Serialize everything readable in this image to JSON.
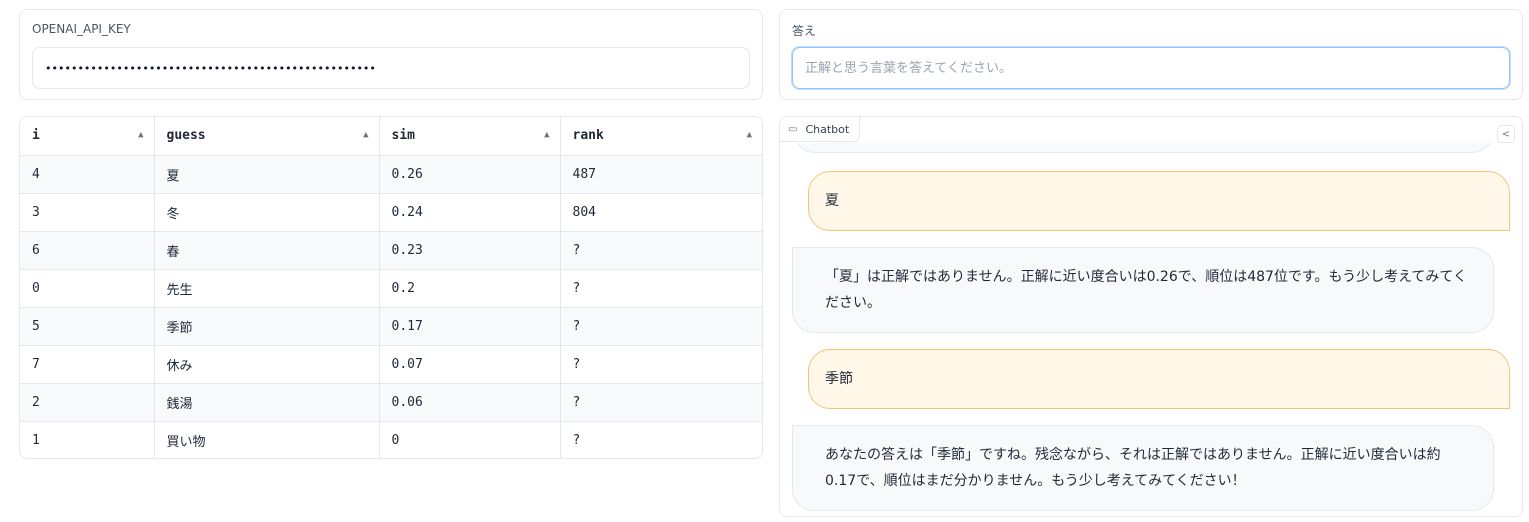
{
  "api_key": {
    "label": "OPENAI_API_KEY",
    "value": "•••••••••••••••••••••••••••••••••••••••••••••••••••"
  },
  "answer": {
    "label": "答え",
    "placeholder": "正解と思う言葉を答えてください。"
  },
  "table": {
    "headers": [
      "i",
      "guess",
      "sim",
      "rank"
    ],
    "rows": [
      [
        "4",
        "夏",
        "0.26",
        "487"
      ],
      [
        "3",
        "冬",
        "0.24",
        "804"
      ],
      [
        "6",
        "春",
        "0.23",
        "?"
      ],
      [
        "0",
        "先生",
        "0.2",
        "?"
      ],
      [
        "5",
        "季節",
        "0.17",
        "?"
      ],
      [
        "7",
        "休み",
        "0.07",
        "?"
      ],
      [
        "2",
        "銭湯",
        "0.06",
        "?"
      ],
      [
        "1",
        "買い物",
        "0",
        "?"
      ]
    ]
  },
  "chatbot": {
    "label": "Chatbot",
    "messages": [
      {
        "role": "user",
        "text": "夏"
      },
      {
        "role": "bot",
        "text": "「夏」は正解ではありません。正解に近い度合いは0.26で、順位は487位です。もう少し考えてみてください。"
      },
      {
        "role": "user",
        "text": "季節"
      },
      {
        "role": "bot",
        "text": "あなたの答えは「季節」ですね。残念ながら、それは正解ではありません。正解に近い度合いは約0.17で、順位はまだ分かりません。もう少し考えてみてください！"
      }
    ]
  },
  "icons": {
    "sort": "sort-arrow-icon",
    "chat": "chat-icon",
    "share": "share-icon"
  }
}
